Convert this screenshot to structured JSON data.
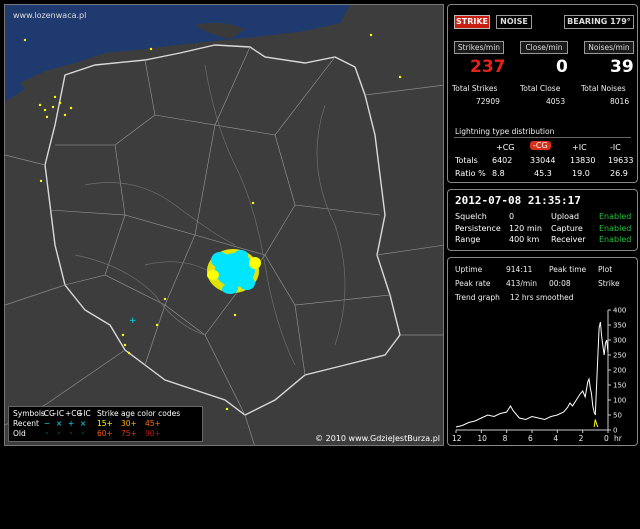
{
  "map": {
    "url_label": "www.lozenwaca.pl",
    "copyright": "© 2010 www.GdzieJestBurza.pl"
  },
  "legend": {
    "symbols_label": "Symbols",
    "types": [
      "-CG",
      "-IC",
      "+CG",
      "+IC"
    ],
    "age_title": "Strike age color codes",
    "recent_label": "Recent",
    "old_label": "Old",
    "recent_symbols": [
      "−",
      "×",
      "+",
      "×"
    ],
    "old_symbols": [
      "·",
      "·",
      "·",
      "·"
    ],
    "recent_ages": [
      "15+",
      "30+",
      "45+"
    ],
    "old_ages": [
      "60+",
      "75+",
      "90+"
    ],
    "age_colors_recent": [
      "#ffff00",
      "#ffb000",
      "#ff7000"
    ],
    "age_colors_old": [
      "#ff5010",
      "#e03010",
      "#c01010"
    ]
  },
  "controls": {
    "strike": "STRIKE",
    "noise": "NOISE",
    "bearing": "BEARING 179°"
  },
  "stats": {
    "strikes_label": "Strikes/min",
    "close_label": "Close/min",
    "noises_label": "Noises/min",
    "strikes_value": "237",
    "close_value": "0",
    "noises_value": "39",
    "total_strikes_label": "Total Strikes",
    "total_close_label": "Total Close",
    "total_noises_label": "Total Noises",
    "total_strikes": "72909",
    "total_close": "4053",
    "total_noises": "8016"
  },
  "distribution": {
    "title": "Lightning type distribution",
    "headers": [
      "+CG",
      "-CG",
      "+IC",
      "-IC"
    ],
    "totals_label": "Totals",
    "totals": [
      "6402",
      "33044",
      "13830",
      "19633"
    ],
    "ratio_label": "Ratio %",
    "ratios": [
      "8.8",
      "45.3",
      "19.0",
      "26.9"
    ]
  },
  "status": {
    "timestamp": "2012-07-08 21:35:17",
    "squelch_label": "Squelch",
    "squelch": "0",
    "upload_label": "Upload",
    "upload": "Enabled",
    "persistence_label": "Persistence",
    "persistence": "120 min",
    "capture_label": "Capture",
    "capture": "Enabled",
    "range_label": "Range",
    "range": "400 km",
    "receiver_label": "Receiver",
    "receiver": "Enabled"
  },
  "trend": {
    "uptime_label": "Uptime",
    "uptime": "914:11",
    "peak_time_label": "Peak time",
    "plot_label": "Plot",
    "peak_rate_label": "Peak rate",
    "peak_rate": "413/min",
    "peak_time": "00:08",
    "plot_value": "Strike",
    "trend_label": "Trend graph",
    "trend_desc": "12 hrs smoothed",
    "y_ticks": [
      "400",
      "350",
      "300",
      "250",
      "200",
      "150",
      "100",
      "50",
      "0"
    ],
    "x_ticks": [
      "12",
      "10",
      "8",
      "6",
      "4",
      "2",
      "0"
    ],
    "x_unit": "hr"
  },
  "chart_data": {
    "type": "line",
    "title": "",
    "xlabel": "hr",
    "ylabel": "",
    "xlim": [
      12,
      0
    ],
    "ylim": [
      0,
      400
    ],
    "series": [
      {
        "x": [
          12.0,
          11.5,
          11.0,
          10.5,
          10.0,
          9.5,
          9.0,
          8.5,
          8.0,
          7.7,
          7.5,
          7.0,
          6.5,
          6.0,
          5.5,
          5.0,
          4.5,
          4.0,
          3.5,
          3.2,
          3.0,
          2.8,
          2.5,
          2.2,
          2.0,
          1.8,
          1.6,
          1.5,
          1.4,
          1.3,
          1.2,
          1.1,
          1.0,
          0.9,
          0.8,
          0.7,
          0.6,
          0.5,
          0.4,
          0.3,
          0.2,
          0.1,
          0.0
        ],
        "y": [
          10,
          15,
          25,
          30,
          40,
          50,
          45,
          55,
          60,
          80,
          65,
          40,
          35,
          45,
          40,
          35,
          45,
          50,
          60,
          75,
          90,
          80,
          100,
          120,
          130,
          110,
          160,
          170,
          140,
          120,
          80,
          60,
          50,
          150,
          250,
          340,
          360,
          310,
          280,
          250,
          290,
          300,
          260
        ]
      },
      {
        "name": "",
        "x": [
          1.1,
          1.0,
          0.9,
          0.8
        ],
        "y": [
          10,
          35,
          20,
          10
        ]
      }
    ]
  }
}
